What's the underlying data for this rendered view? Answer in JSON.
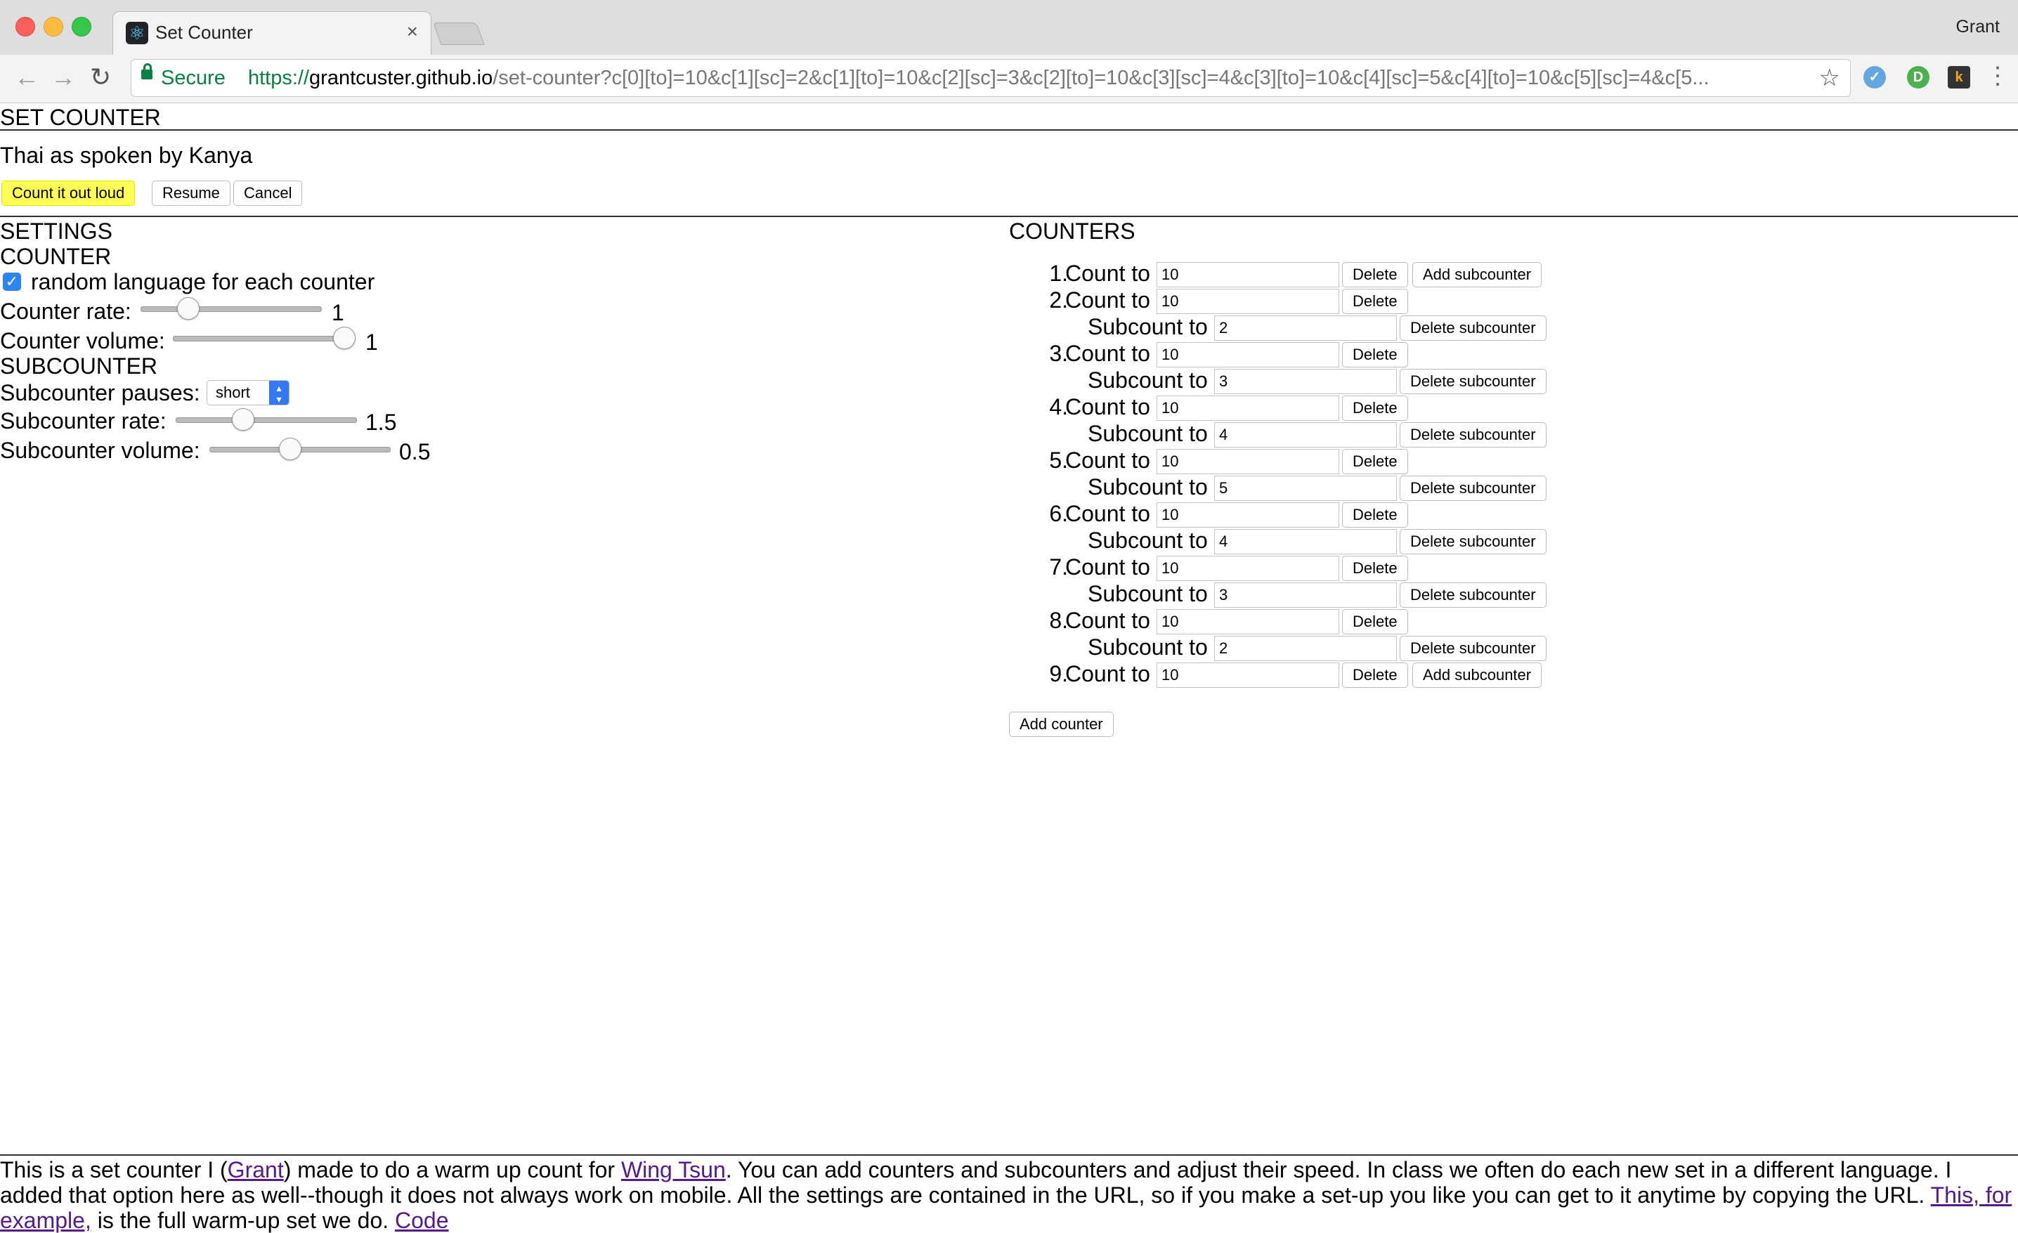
{
  "browser": {
    "tab_title": "Set Counter",
    "tab_close": "×",
    "profile_name": "Grant",
    "secure_label": "Secure",
    "url_scheme": "https://",
    "url_host": "grantcuster.github.io",
    "url_rest": "/set-counter?c[0][to]=10&c[1][sc]=2&c[1][to]=10&c[2][sc]=3&c[2][to]=10&c[3][sc]=4&c[3][to]=10&c[4][sc]=5&c[4][to]=10&c[5][sc]=4&c[5...",
    "back_icon": "←",
    "forward_icon": "→",
    "reload_icon": "↻",
    "star_icon": "☆",
    "menu_icon": "⋮",
    "ext_letters": [
      "✓",
      "D",
      "k"
    ]
  },
  "header": {
    "title": "SET COUNTER",
    "subtitle": "Thai as spoken by Kanya",
    "count_button": "Count it out loud",
    "resume_button": "Resume",
    "cancel_button": "Cancel"
  },
  "settings": {
    "heading": "SETTINGS",
    "counter_heading": "COUNTER",
    "checkbox_mark": "✓",
    "random_language_label": "random language for each counter",
    "random_language_checked": true,
    "counter_rate_label": "Counter rate:",
    "counter_rate_value": "1",
    "counter_rate_fraction": 0.26,
    "counter_volume_label": "Counter volume:",
    "counter_volume_value": "1",
    "counter_volume_fraction": 0.94,
    "subcounter_heading": "SUBCOUNTER",
    "subcounter_pauses_label": "Subcounter pauses:",
    "subcounter_pauses_value": "short",
    "select_arrows": "▴\n▾",
    "subcounter_rate_label": "Subcounter rate:",
    "subcounter_rate_value": "1.5",
    "subcounter_rate_fraction": 0.37,
    "subcounter_volume_label": "Subcounter volume:",
    "subcounter_volume_value": "0.5",
    "subcounter_volume_fraction": 0.44
  },
  "counters": {
    "heading": "COUNTERS",
    "count_to_label": "Count to",
    "subcount_to_label": "Subcount to",
    "delete_label": "Delete",
    "add_subcounter_label": "Add subcounter",
    "delete_subcounter_label": "Delete subcounter",
    "add_counter_label": "Add counter",
    "items": [
      {
        "number": "1.",
        "count": "10",
        "subcount": null
      },
      {
        "number": "2.",
        "count": "10",
        "subcount": "2"
      },
      {
        "number": "3.",
        "count": "10",
        "subcount": "3"
      },
      {
        "number": "4.",
        "count": "10",
        "subcount": "4"
      },
      {
        "number": "5.",
        "count": "10",
        "subcount": "5"
      },
      {
        "number": "6.",
        "count": "10",
        "subcount": "4"
      },
      {
        "number": "7.",
        "count": "10",
        "subcount": "3"
      },
      {
        "number": "8.",
        "count": "10",
        "subcount": "2"
      },
      {
        "number": "9.",
        "count": "10",
        "subcount": null
      }
    ]
  },
  "footer": {
    "t1": "This is a set counter I (",
    "link_grant": "Grant",
    "t2": ") made to do a warm up count for ",
    "link_wing_tsun": "Wing Tsun",
    "t3": ". You can add counters and subcounters and adjust their speed. In class we often do each new set in a different language. I added that option here as well--though it does not always work on mobile. All the settings are contained in the URL, so if you make a set-up you like you can get to it anytime by copying the URL. ",
    "link_example": "This, for example,",
    "t4": " is the full warm-up set we do. ",
    "link_code": "Code"
  }
}
